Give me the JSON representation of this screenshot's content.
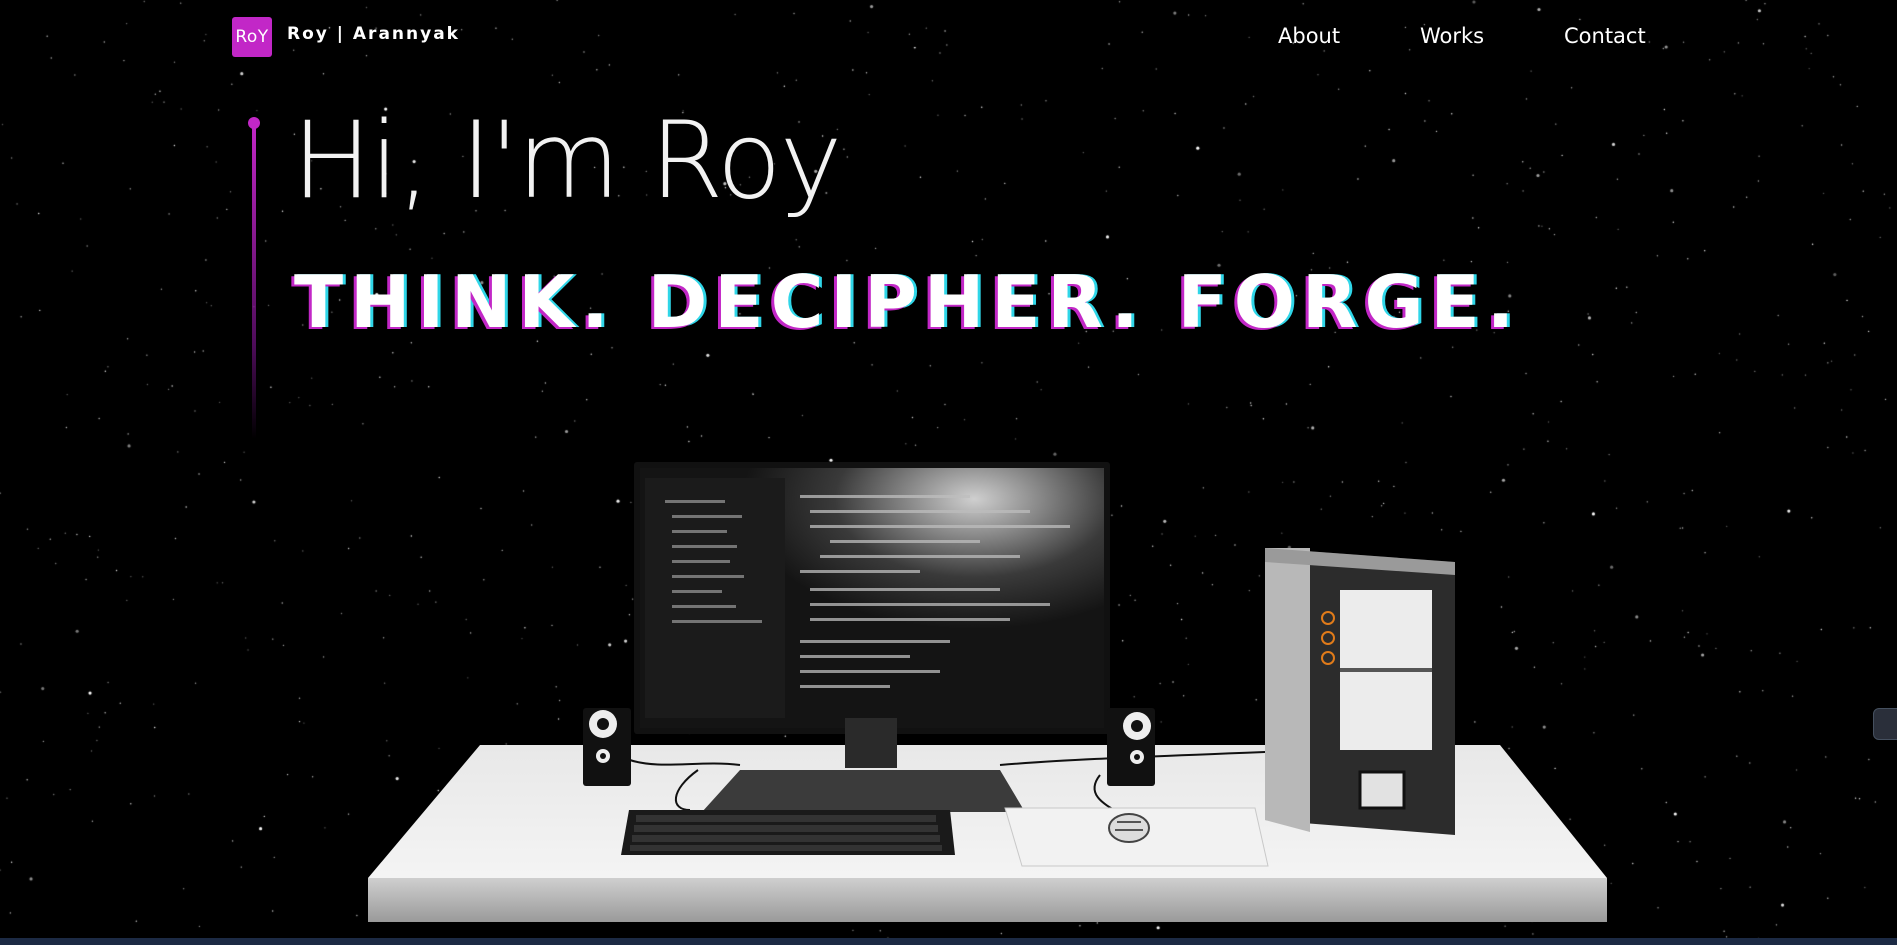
{
  "nav": {
    "logo_text": "RoY",
    "brand": "Roy | Arannyak",
    "links": [
      "About",
      "Works",
      "Contact"
    ]
  },
  "hero": {
    "greeting": "Hi, I'm Roy",
    "tagline": "THINK. DECIPHER. FORGE."
  },
  "colors": {
    "accent": "#c227c7",
    "accent_alt": "#2fd6e8",
    "background": "#000000",
    "text": "#ffffff"
  },
  "scene": {
    "description_icons": [
      "desk",
      "monitor",
      "keyboard",
      "mouse",
      "speaker",
      "pc-case"
    ]
  }
}
